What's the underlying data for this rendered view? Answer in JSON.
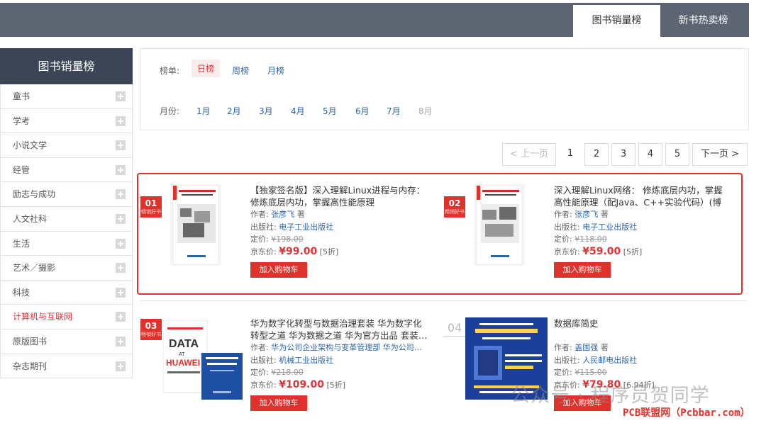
{
  "top_tabs": [
    {
      "label": "图书销量榜"
    },
    {
      "label": "新书热卖榜"
    }
  ],
  "sidebar": {
    "title": "图书销量榜",
    "items": [
      {
        "label": "童书"
      },
      {
        "label": "学考"
      },
      {
        "label": "小说文学"
      },
      {
        "label": "经管"
      },
      {
        "label": "励志与成功"
      },
      {
        "label": "人文社科"
      },
      {
        "label": "生活"
      },
      {
        "label": "艺术／摄影"
      },
      {
        "label": "科技"
      },
      {
        "label": "计算机与互联网"
      },
      {
        "label": "原版图书"
      },
      {
        "label": "杂志期刊"
      }
    ],
    "active_index": 9
  },
  "filter": {
    "list_label": "榜单:",
    "lists": [
      "日榜",
      "周榜",
      "月榜"
    ],
    "month_label": "月份:",
    "months": [
      "1月",
      "2月",
      "3月",
      "4月",
      "5月",
      "6月",
      "7月",
      "8月"
    ]
  },
  "pagination": {
    "prev": "< 上一页",
    "pages": [
      "1",
      "2",
      "3",
      "4",
      "5"
    ],
    "next": "下一页 >"
  },
  "books": [
    {
      "rank": "01",
      "badge": "畅销好书",
      "title": "【独家签名版】深入理解Linux进程与内存：修炼底层内功，掌握高性能原理",
      "author_label": "作者:",
      "author": "张彦飞",
      "author_suffix": "著",
      "publisher_label": "出版社:",
      "publisher": "电子工业出版社",
      "list_price_label": "定价:",
      "list_price": "¥198.00",
      "jd_price_label": "京东价:",
      "jd_price": "¥99.00",
      "discount": "[5折]",
      "cart": "加入购物车",
      "cover_title": "深入理解Linux进程与内存"
    },
    {
      "rank": "02",
      "badge": "畅销好书",
      "title": "深入理解Linux网络： 修炼底层内功，掌握高性能原理（配Java、C++实验代码）(博文…",
      "author_label": "作者:",
      "author": "张彦飞",
      "author_suffix": "著",
      "publisher_label": "出版社:",
      "publisher": "电子工业出版社",
      "list_price_label": "定价:",
      "list_price": "¥118.00",
      "jd_price_label": "京东价:",
      "jd_price": "¥59.00",
      "discount": "[5折]",
      "cart": "加入购物车",
      "cover_title": "深入理解Linux网络"
    },
    {
      "rank": "03",
      "badge": "畅销好书",
      "title": "华为数字化转型与数据治理套装 华为数字化转型之道 华为数据之道 华为官方出品 套装…",
      "author_label": "作者:",
      "author": "华为公司企业架构与变革管理部",
      "author_extra": "华为公司…",
      "author_suffix": "",
      "publisher_label": "出版社:",
      "publisher": "机械工业出版社",
      "list_price_label": "定价:",
      "list_price": "¥218.00",
      "jd_price_label": "京东价:",
      "jd_price": "¥109.00",
      "discount": "[5折]",
      "cart": "加入购物车",
      "cover_title": "DATA AT HUAWEI"
    },
    {
      "rank": "04",
      "title": "数据库简史",
      "author_label": "作者:",
      "author": "盖国强",
      "author_suffix": "著",
      "publisher_label": "出版社:",
      "publisher": "人民邮电出版社",
      "list_price_label": "定价:",
      "list_price": "¥115.00",
      "jd_price_label": "京东价:",
      "jd_price": "¥79.80",
      "discount": "[6.94折]",
      "cart": "加入购物车",
      "cover_title": "数据库简史"
    }
  ],
  "watermark": {
    "text": "公众号 · 程序员贺同学",
    "site": "PCB联盟网（Pcbbar.com）"
  },
  "colors": {
    "topbar": "#5d6472",
    "sidebar_header": "#3b4556",
    "accent_red": "#e0322c",
    "link_blue": "#2a66a8"
  }
}
